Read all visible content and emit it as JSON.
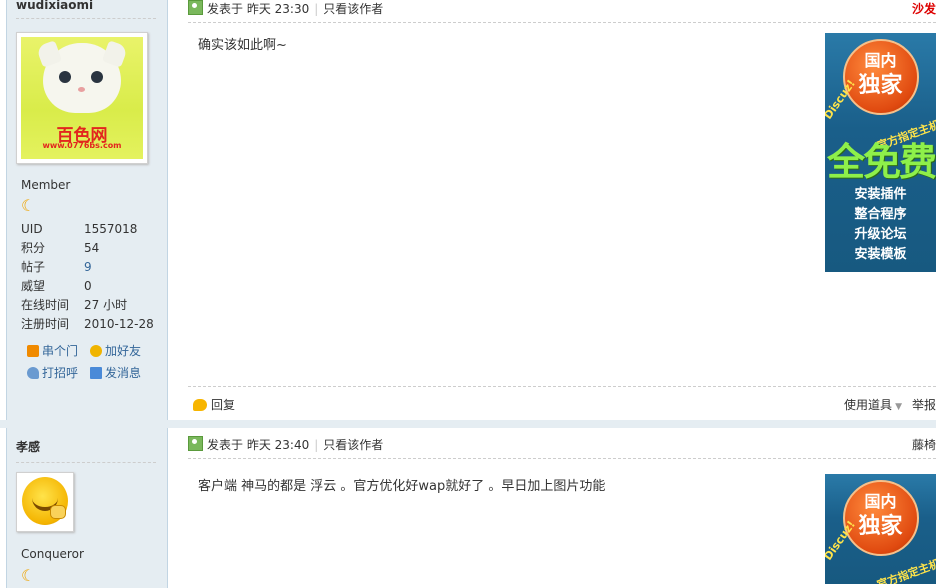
{
  "posts": [
    {
      "username": "wudixiaomi",
      "group": "Member",
      "stats": [
        {
          "label": "UID",
          "value": "1557018"
        },
        {
          "label": "积分",
          "value": "54"
        },
        {
          "label": "帖子",
          "value": "9"
        },
        {
          "label": "威望",
          "value": "0"
        },
        {
          "label": "在线时间",
          "value": "27 小时"
        },
        {
          "label": "注册时间",
          "value": "2010-12-28"
        }
      ],
      "actions": {
        "visit": "串个门",
        "add_friend": "加好友",
        "greet": "打招呼",
        "message": "发消息"
      },
      "avatar_text": "百色网",
      "avatar_url": "www.0776bs.com",
      "posted_at": "发表于 昨天 23:30",
      "only_author": "只看该作者",
      "floor": "沙发",
      "message": "确实该如此啊~",
      "reply": "回复",
      "tools": "使用道具",
      "report": "举报"
    },
    {
      "username": "孝感",
      "group": "Conqueror",
      "posted_at": "发表于 昨天 23:40",
      "only_author": "只看该作者",
      "floor": "藤椅",
      "message": "客户端 神马的都是 浮云 。官方优化好wap就好了 。早日加上图片功能"
    }
  ],
  "ad": {
    "badge_top": "国内",
    "badge_bottom": "独家",
    "curve_left": "Discuz!",
    "curve_right": "官方指定主机商",
    "headline": "全免费",
    "features": [
      "安装插件",
      "整合程序",
      "升级论坛",
      "安装模板"
    ]
  },
  "colors": {
    "sidebar_bg": "#e5edf2",
    "link": "#336699",
    "floor_red": "#dd0000"
  }
}
